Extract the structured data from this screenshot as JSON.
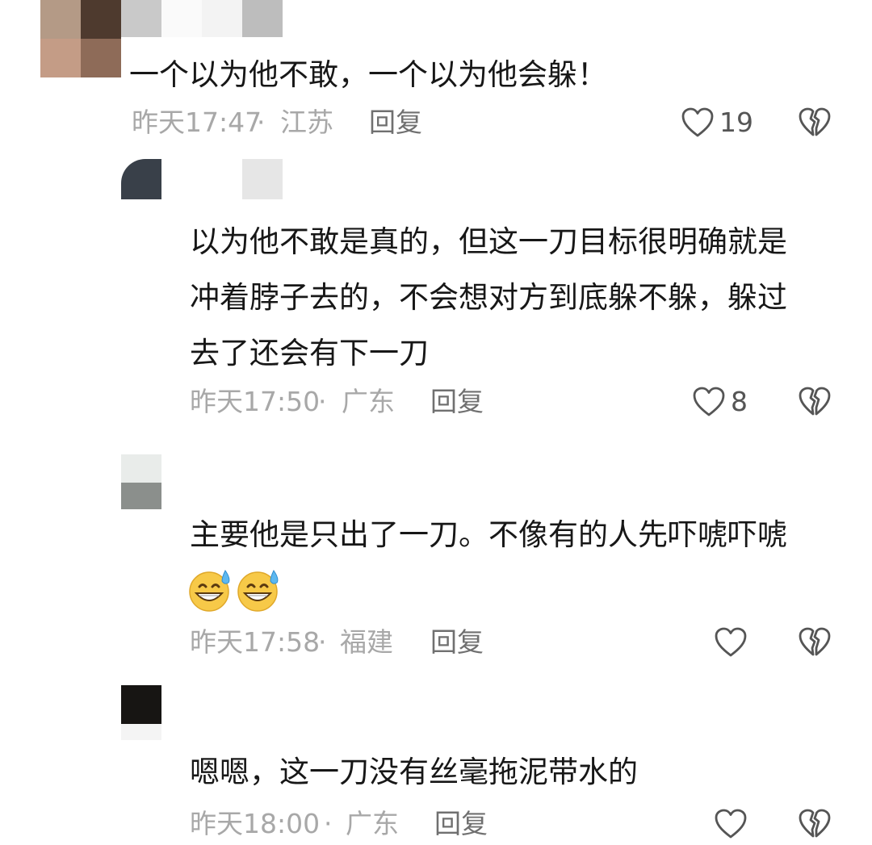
{
  "comments": [
    {
      "text": "一个以为他不敢，一个以为他会躲！",
      "time": "昨天17:47",
      "location": "江苏",
      "reply_label": "回复",
      "likes": "19"
    },
    {
      "text_lines": [
        "以为他不敢是真的，但这一刀目标很明确就是",
        "冲着脖子去的，不会想对方到底躲不躲，躲过",
        "去了还会有下一刀"
      ],
      "time": "昨天17:50",
      "location": "广东",
      "reply_label": "回复",
      "likes": "8"
    },
    {
      "text": "主要他是只出了一刀。不像有的人先吓唬吓唬",
      "emoji": [
        "grinning-sweat-emoji",
        "grinning-sweat-emoji"
      ],
      "time": "昨天17:58",
      "location": "福建",
      "reply_label": "回复",
      "likes": ""
    },
    {
      "text": "嗯嗯，这一刀没有丝毫拖泥带水的",
      "time": "昨天18:00",
      "location": "广东",
      "reply_label": "回复",
      "likes": ""
    }
  ],
  "separator": "·",
  "icons": {
    "like": "heart-outline-icon",
    "dislike": "broken-heart-icon"
  },
  "colors": {
    "text": "#171717",
    "meta": "#a8a8a8",
    "reply": "#707070",
    "icon": "#555555"
  }
}
